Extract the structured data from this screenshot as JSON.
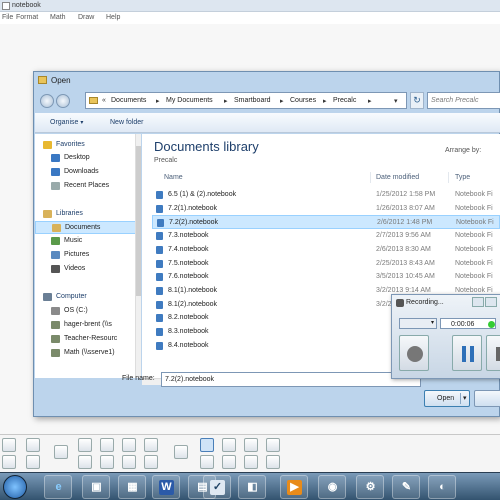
{
  "app": {
    "title": "notebook",
    "menu": [
      "File",
      "Format",
      "Math",
      "Draw",
      "Help"
    ]
  },
  "dialog": {
    "title": "Open",
    "breadcrumb": [
      "Documents",
      "My Documents",
      "Smartboard",
      "Courses",
      "Precalc"
    ],
    "search_placeholder": "Search Precalc",
    "organize_label": "Organise",
    "new_folder_label": "New folder",
    "library_title": "Documents library",
    "library_subtitle": "Precalc",
    "arrange_label": "Arrange by:",
    "columns": {
      "name": "Name",
      "date": "Date modified",
      "type": "Type"
    },
    "nav": [
      {
        "label": "Favorites",
        "icon": "star-icon",
        "indent": 0
      },
      {
        "label": "Desktop",
        "icon": "desktop-icon",
        "indent": 1
      },
      {
        "label": "Downloads",
        "icon": "downloads-icon",
        "indent": 1
      },
      {
        "label": "Recent Places",
        "icon": "recent-places-icon",
        "indent": 1
      },
      {
        "label": "Libraries",
        "icon": "libraries-icon",
        "indent": 0
      },
      {
        "label": "Documents",
        "icon": "documents-icon",
        "indent": 1,
        "selected": true
      },
      {
        "label": "Music",
        "icon": "music-icon",
        "indent": 1
      },
      {
        "label": "Pictures",
        "icon": "pictures-icon",
        "indent": 1
      },
      {
        "label": "Videos",
        "icon": "videos-icon",
        "indent": 1
      },
      {
        "label": "Computer",
        "icon": "computer-icon",
        "indent": 0
      },
      {
        "label": "OS (C:)",
        "icon": "drive-icon",
        "indent": 1
      },
      {
        "label": "hager-brent (\\\\s",
        "icon": "network-drive-icon",
        "indent": 1
      },
      {
        "label": "Teacher-Resourc",
        "icon": "network-drive-icon",
        "indent": 1
      },
      {
        "label": "Math (\\\\sserve1)",
        "icon": "network-drive-icon",
        "indent": 1
      }
    ],
    "files": [
      {
        "name": "6.5 (1) & (2).notebook",
        "date": "1/25/2012 1:58 PM",
        "type": "Notebook Fi"
      },
      {
        "name": "7.2(1).notebook",
        "date": "1/26/2013 8:07 AM",
        "type": "Notebook Fi"
      },
      {
        "name": "7.2(2).notebook",
        "date": "2/6/2012 1:48 PM",
        "type": "Notebook Fi",
        "selected": true
      },
      {
        "name": "7.3.notebook",
        "date": "2/7/2013 9:56 AM",
        "type": "Notebook Fi"
      },
      {
        "name": "7.4.notebook",
        "date": "2/6/2013 8:30 AM",
        "type": "Notebook Fi"
      },
      {
        "name": "7.5.notebook",
        "date": "2/25/2013 8:43 AM",
        "type": "Notebook Fi"
      },
      {
        "name": "7.6.notebook",
        "date": "3/5/2013 10:45 AM",
        "type": "Notebook Fi"
      },
      {
        "name": "8.1(1).notebook",
        "date": "3/2/2013 9:14 AM",
        "type": "Notebook Fi"
      },
      {
        "name": "8.1(2).notebook",
        "date": "3/2/2013 9:13 AM",
        "type": "Notebook Fi"
      },
      {
        "name": "8.2.notebook",
        "date": "",
        "type": ""
      },
      {
        "name": "8.3.notebook",
        "date": "",
        "type": ""
      },
      {
        "name": "8.4.notebook",
        "date": "",
        "type": ""
      }
    ],
    "filename_label": "File name:",
    "filename_value": "7.2(2).notebook",
    "open_label": "Open"
  },
  "recorder": {
    "title": "Recording...",
    "time": "0:00:06"
  },
  "colors": {
    "dialog_frame": "#bcd4ec",
    "selection": "#cce8ff",
    "accent_title": "#1e3f6b"
  }
}
